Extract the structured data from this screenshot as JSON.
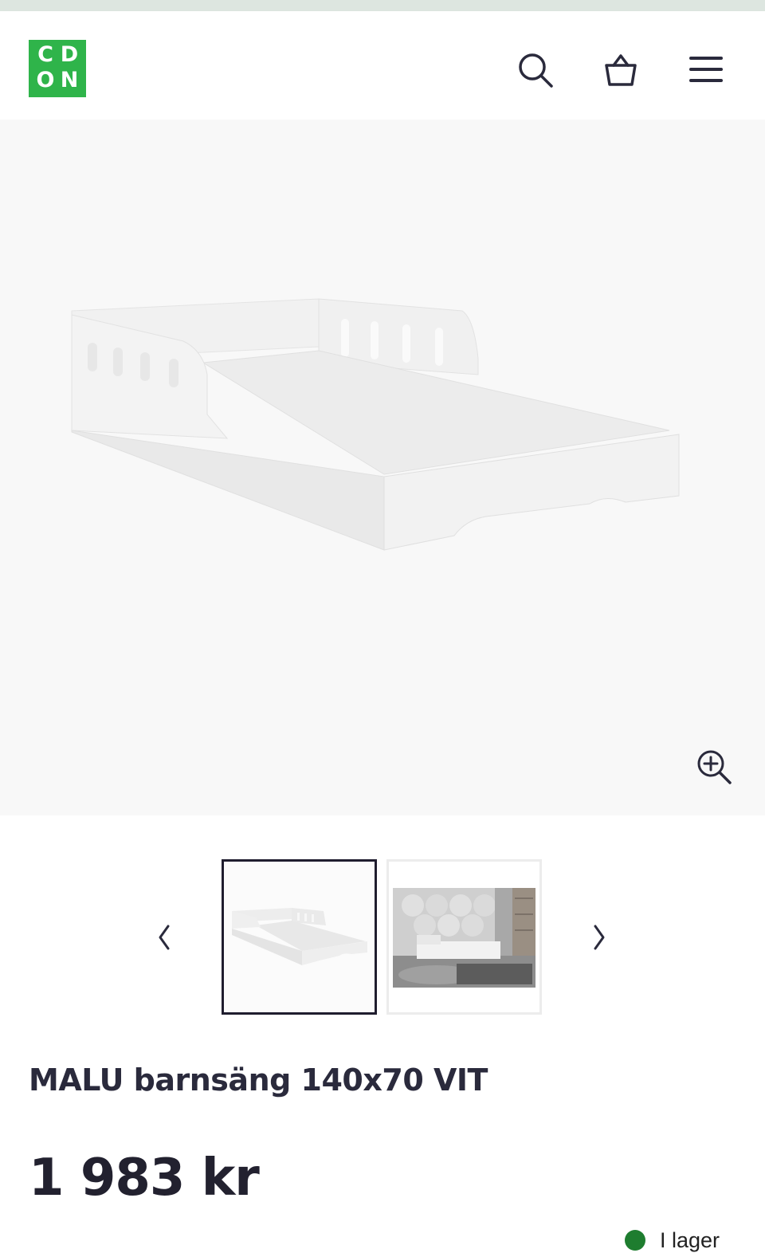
{
  "brand": {
    "logo_letters": [
      "C",
      "D",
      "O",
      "N"
    ],
    "logo_color": "#2fb44a"
  },
  "header": {
    "icons": [
      "search-icon",
      "basket-icon",
      "menu-icon"
    ]
  },
  "gallery": {
    "main_image": "white toddler bed with side rails",
    "zoom_icon": "zoom-in-icon",
    "prev_icon": "chevron-left-icon",
    "next_icon": "chevron-right-icon",
    "thumbnails": [
      {
        "image": "bed on white background",
        "selected": true
      },
      {
        "image": "bed in kids room",
        "selected": false
      }
    ]
  },
  "product": {
    "title": "MALU barnsäng 140x70 VIT",
    "price": "1 983 kr",
    "stock_label": "I lager",
    "stock_color": "#1e7d2f"
  }
}
